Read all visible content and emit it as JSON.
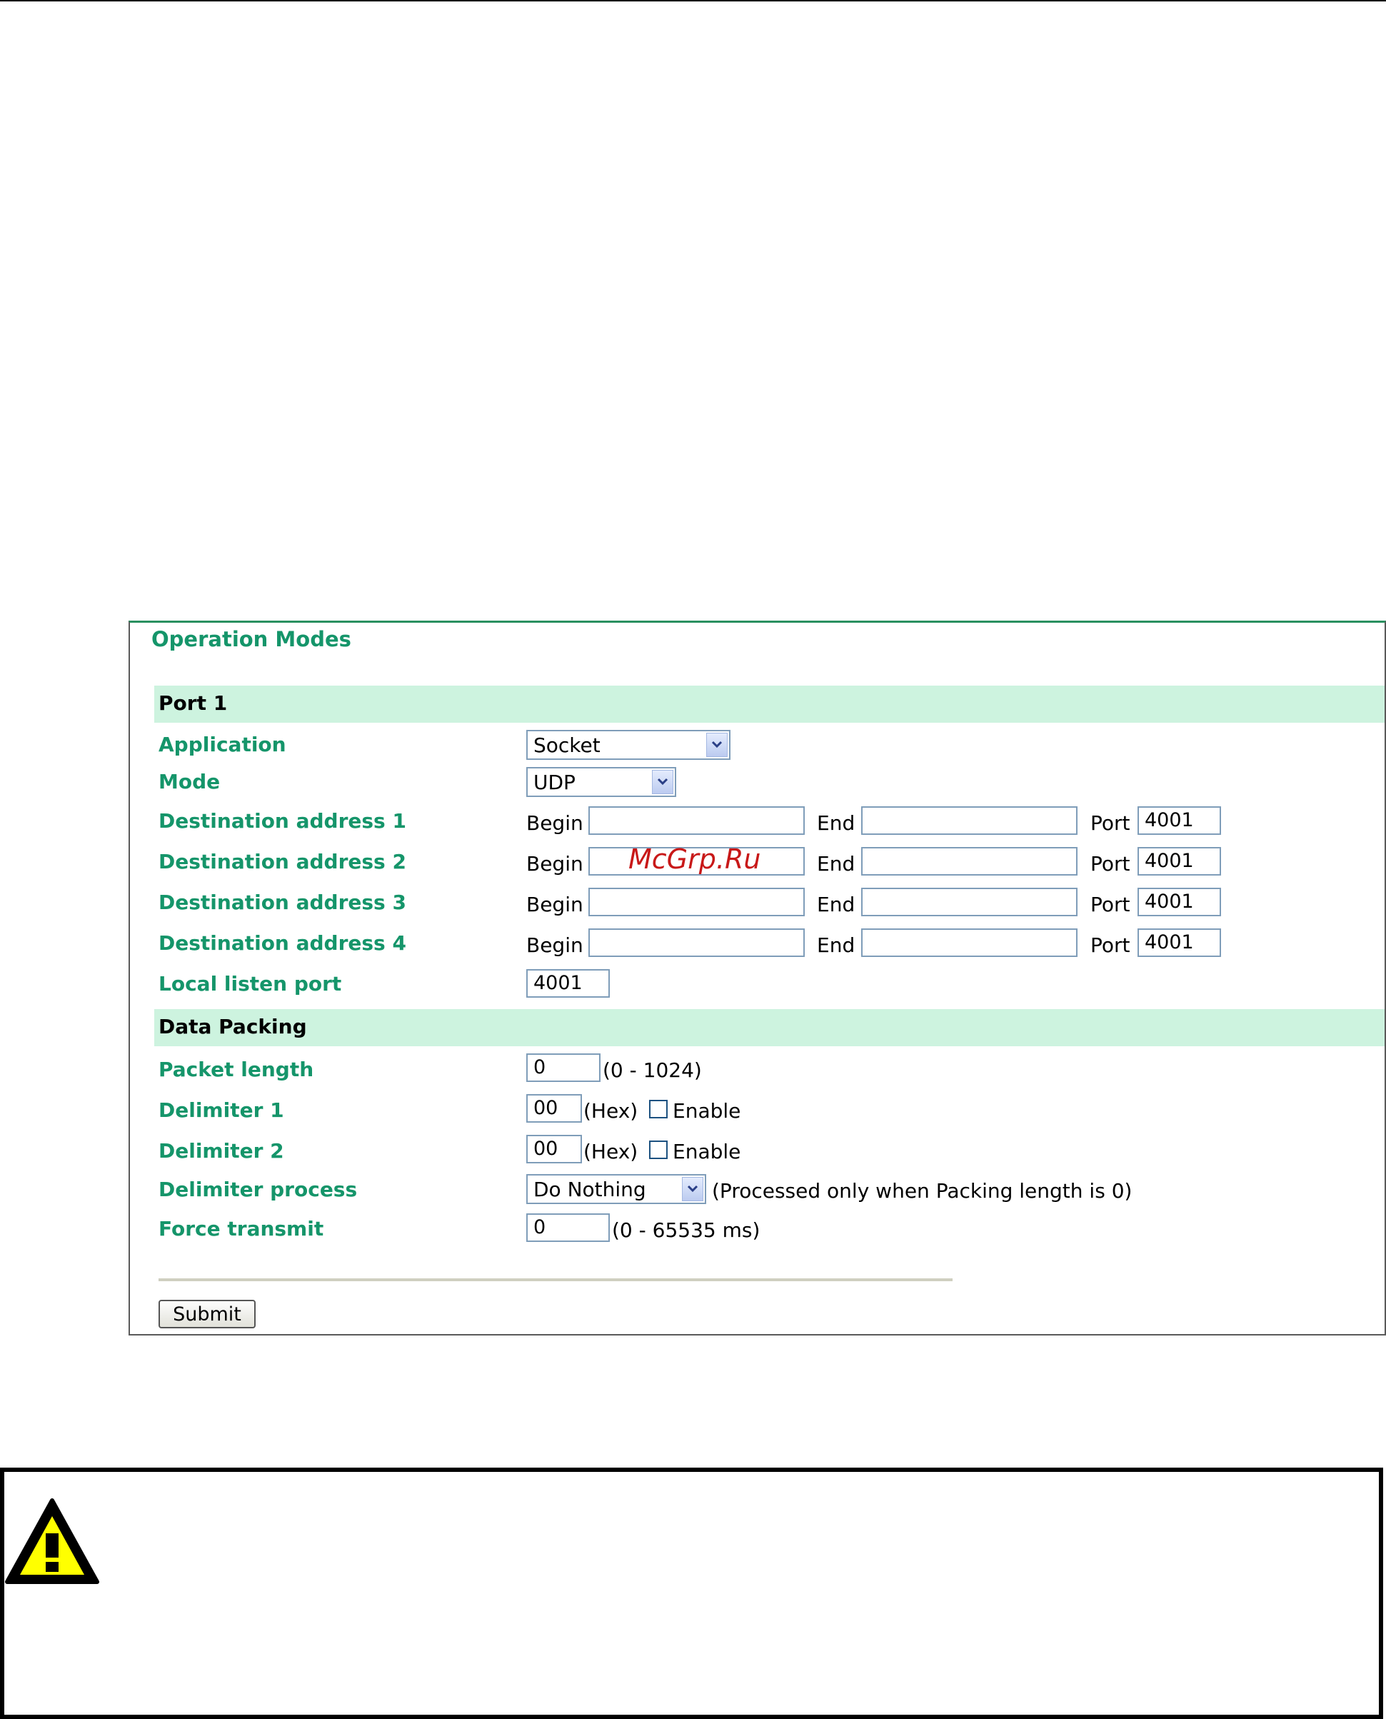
{
  "panel": {
    "title": "Operation Modes"
  },
  "port_section": {
    "title": "Port 1"
  },
  "application": {
    "label": "Application",
    "value": "Socket"
  },
  "mode": {
    "label": "Mode",
    "value": "UDP"
  },
  "destinations": [
    {
      "label": "Destination address 1",
      "begin_label": "Begin",
      "begin": "",
      "end_label": "End",
      "end": "",
      "port_label": "Port",
      "port": "4001"
    },
    {
      "label": "Destination address 2",
      "begin_label": "Begin",
      "begin": "",
      "end_label": "End",
      "end": "",
      "port_label": "Port",
      "port": "4001"
    },
    {
      "label": "Destination address 3",
      "begin_label": "Begin",
      "begin": "",
      "end_label": "End",
      "end": "",
      "port_label": "Port",
      "port": "4001"
    },
    {
      "label": "Destination address 4",
      "begin_label": "Begin",
      "begin": "",
      "end_label": "End",
      "end": "",
      "port_label": "Port",
      "port": "4001"
    }
  ],
  "local_listen_port": {
    "label": "Local listen port",
    "value": "4001"
  },
  "data_packing": {
    "title": "Data Packing"
  },
  "packet_length": {
    "label": "Packet length",
    "value": "0",
    "hint": "(0 - 1024)"
  },
  "delimiter1": {
    "label": "Delimiter 1",
    "value": "00",
    "hint": "(Hex)",
    "enable_label": "Enable",
    "enabled": false
  },
  "delimiter2": {
    "label": "Delimiter 2",
    "value": "00",
    "hint": "(Hex)",
    "enable_label": "Enable",
    "enabled": false
  },
  "delimiter_process": {
    "label": "Delimiter process",
    "value": "Do Nothing",
    "hint": "(Processed only when Packing length is 0)"
  },
  "force_transmit": {
    "label": "Force transmit",
    "value": "0",
    "hint": "(0 - 65535 ms)"
  },
  "submit_label": "Submit",
  "watermark": "McGrp.Ru",
  "icons": {
    "dropdown": "chevron-down-icon",
    "warning": "warning-triangle-icon"
  },
  "colors": {
    "label_green": "#15956a",
    "section_bg": "#cdf3df",
    "warning_yellow": "#ffff00"
  }
}
